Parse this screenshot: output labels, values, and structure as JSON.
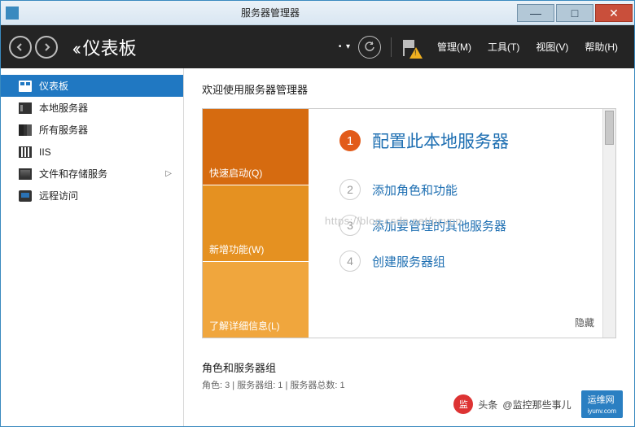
{
  "window": {
    "title": "服务器管理器"
  },
  "nav": {
    "page_title": "仪表板",
    "menu": {
      "manage": "管理(M)",
      "tools": "工具(T)",
      "view": "视图(V)",
      "help": "帮助(H)"
    }
  },
  "sidebar": {
    "items": [
      {
        "label": "仪表板",
        "icon": "dash",
        "active": true
      },
      {
        "label": "本地服务器",
        "icon": "srv"
      },
      {
        "label": "所有服务器",
        "icon": "all"
      },
      {
        "label": "IIS",
        "icon": "iis"
      },
      {
        "label": "文件和存储服务",
        "icon": "file",
        "expandable": true
      },
      {
        "label": "远程访问",
        "icon": "remote"
      }
    ]
  },
  "welcome": {
    "heading": "欢迎使用服务器管理器",
    "tabs": {
      "quickstart": "快速启动(Q)",
      "whatsnew": "新增功能(W)",
      "learnmore": "了解详细信息(L)"
    },
    "steps": [
      {
        "num": "1",
        "label": "配置此本地服务器",
        "primary": true
      },
      {
        "num": "2",
        "label": "添加角色和功能"
      },
      {
        "num": "3",
        "label": "添加要管理的其他服务器"
      },
      {
        "num": "4",
        "label": "创建服务器组"
      }
    ],
    "hide": "隐藏",
    "watermark": "https://blog.csdn.net/pcvpn"
  },
  "roles": {
    "title": "角色和服务器组",
    "subtitle": "角色: 3 | 服务器组: 1 | 服务器总数: 1"
  },
  "footer": {
    "source_prefix": "头条",
    "source": "@监控那些事儿",
    "brand": "运维网",
    "brand_sub": "iyunv.com"
  }
}
